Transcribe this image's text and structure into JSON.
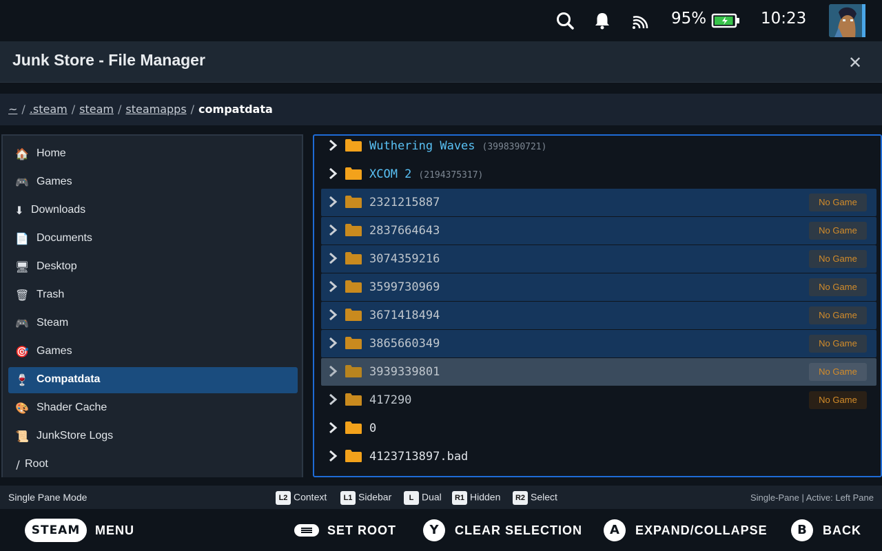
{
  "status_bar": {
    "battery_percent": "95%",
    "battery_level": 0.95,
    "time": "10:23",
    "icons": [
      "search-icon",
      "bell-icon",
      "cast-icon",
      "battery-icon",
      "avatar"
    ]
  },
  "header": {
    "title": "Junk Store - File Manager",
    "close_icon": "close-icon"
  },
  "breadcrumb": {
    "items": [
      "~",
      ".steam",
      "steam",
      "steamapps"
    ],
    "current": "compatdata",
    "separator": "/"
  },
  "sidebar": {
    "items": [
      {
        "icon": "🏠",
        "label": "Home"
      },
      {
        "icon": "🎮",
        "label": "Games"
      },
      {
        "icon": "⬇",
        "label": "Downloads"
      },
      {
        "icon": "📄",
        "label": "Documents"
      },
      {
        "icon": "🖥",
        "label": "Desktop"
      },
      {
        "icon": "🗑",
        "label": "Trash"
      },
      {
        "icon": "🎮",
        "label": "Steam"
      },
      {
        "icon": "🎯",
        "label": "Games"
      },
      {
        "icon": "🍷",
        "label": "Compatdata"
      },
      {
        "icon": "🎨",
        "label": "Shader Cache"
      },
      {
        "icon": "📜",
        "label": "JunkStore Logs"
      },
      {
        "icon": "/",
        "label": "Root"
      }
    ],
    "active_index": 8
  },
  "files": [
    {
      "name": "Wuthering Waves",
      "id": "(3998390721)",
      "badge": ""
    },
    {
      "name": "XCOM 2",
      "id": "(2194375317)",
      "badge": ""
    },
    {
      "name": "2321215887",
      "id": "",
      "badge": "No Game"
    },
    {
      "name": "2837664643",
      "id": "",
      "badge": "No Game"
    },
    {
      "name": "3074359216",
      "id": "",
      "badge": "No Game"
    },
    {
      "name": "3599730969",
      "id": "",
      "badge": "No Game"
    },
    {
      "name": "3671418494",
      "id": "",
      "badge": "No Game"
    },
    {
      "name": "3865660349",
      "id": "",
      "badge": "No Game"
    },
    {
      "name": "3939339801",
      "id": "",
      "badge": "No Game"
    },
    {
      "name": "417290",
      "id": "",
      "badge": "No Game"
    },
    {
      "name": "0",
      "id": "",
      "badge": ""
    },
    {
      "name": "4123713897.bad",
      "id": "",
      "badge": ""
    }
  ],
  "hints": {
    "mode": "Single Pane Mode",
    "items": [
      {
        "key": "L2",
        "label": "Context"
      },
      {
        "key": "L1",
        "label": "Sidebar"
      },
      {
        "key": "L",
        "label": "Dual"
      },
      {
        "key": "R1",
        "label": "Hidden"
      },
      {
        "key": "R2",
        "label": "Select"
      }
    ],
    "status": "Single-Pane | Active: Left Pane"
  },
  "footer": {
    "steam": "STEAM",
    "menu": "MENU",
    "set_root": "SET ROOT",
    "y_key": "Y",
    "clear_selection": "CLEAR SELECTION",
    "a_key": "A",
    "expand": "EXPAND/COLLAPSE",
    "b_key": "B",
    "back": "BACK"
  },
  "colors": {
    "accent": "#1e6bd6",
    "selected_row": "#15365c",
    "focused_row": "#3a4b5d",
    "folder": "#f3a21b",
    "game_name": "#59c1f5",
    "badge_text": "#d38c2a"
  }
}
